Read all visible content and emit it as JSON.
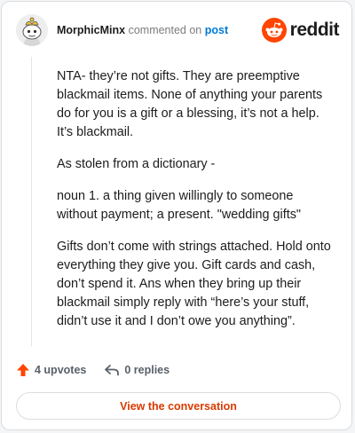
{
  "header": {
    "username": "MorphicMinx",
    "action_text": "commented on",
    "post_link": "post",
    "brand_name": "reddit"
  },
  "comment": {
    "paragraphs": [
      "NTA- they’re not gifts. They are preemptive blackmail items. None of anything your parents do for you is a gift or a blessing, it’s not a help. It’s blackmail.",
      "As stolen from a dictionary -",
      "noun 1. a thing given willingly to someone without payment; a present. \"wedding gifts\"",
      "Gifts don’t come with strings attached. Hold onto everything they give you. Gift cards and cash, don’t spend it. Ans when they bring up their blackmail simply reply with “here’s your stuff, didn’t use it and I don’t owe you anything”."
    ]
  },
  "actions": {
    "upvotes_label": "4 upvotes",
    "replies_label": "0 replies"
  },
  "cta": {
    "label": "View the conversation"
  },
  "colors": {
    "accent": "#d93a00",
    "upvote": "#ff4500",
    "link": "#0079d3",
    "text": "#1c1c1c",
    "muted": "#7c7c7c"
  },
  "icons": [
    "avatar-snoo-icon",
    "reddit-logo-icon",
    "upvote-arrow-icon",
    "reply-arrow-icon"
  ]
}
